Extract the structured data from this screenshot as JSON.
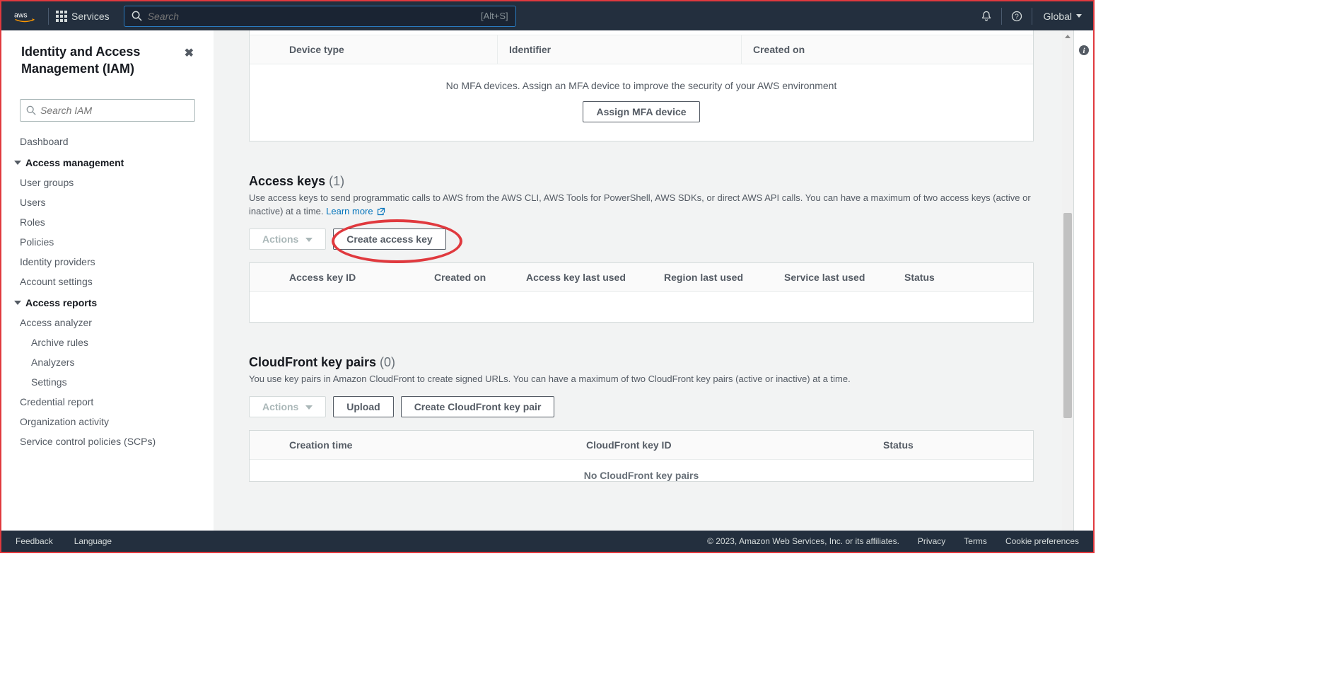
{
  "topnav": {
    "services_label": "Services",
    "search_placeholder": "Search",
    "search_hint": "[Alt+S]",
    "region_label": "Global"
  },
  "sidebar": {
    "title": "Identity and Access Management (IAM)",
    "search_placeholder": "Search IAM",
    "dashboard": "Dashboard",
    "section_access_mgmt": "Access management",
    "items_access_mgmt": {
      "user_groups": "User groups",
      "users": "Users",
      "roles": "Roles",
      "policies": "Policies",
      "identity_providers": "Identity providers",
      "account_settings": "Account settings"
    },
    "section_access_reports": "Access reports",
    "items_access_reports": {
      "access_analyzer": "Access analyzer",
      "archive_rules": "Archive rules",
      "analyzers": "Analyzers",
      "settings": "Settings",
      "credential_report": "Credential report",
      "organization_activity": "Organization activity",
      "scps": "Service control policies (SCPs)"
    }
  },
  "mfa_panel": {
    "columns": {
      "device_type": "Device type",
      "identifier": "Identifier",
      "created_on": "Created on"
    },
    "empty_text": "No MFA devices. Assign an MFA device to improve the security of your AWS environment",
    "assign_button": "Assign MFA device"
  },
  "access_keys": {
    "title": "Access keys",
    "count": "(1)",
    "description": "Use access keys to send programmatic calls to AWS from the AWS CLI, AWS Tools for PowerShell, AWS SDKs, or direct AWS API calls. You can have a maximum of two access keys (active or inactive) at a time.",
    "learn_more": "Learn more",
    "actions_btn": "Actions",
    "create_btn": "Create access key",
    "columns": {
      "access_key_id": "Access key ID",
      "created_on": "Created on",
      "last_used": "Access key last used",
      "region_last_used": "Region last used",
      "service_last_used": "Service last used",
      "status": "Status"
    }
  },
  "cloudfront": {
    "title": "CloudFront key pairs",
    "count": "(0)",
    "description": "You use key pairs in Amazon CloudFront to create signed URLs. You can have a maximum of two CloudFront key pairs (active or inactive) at a time.",
    "actions_btn": "Actions",
    "upload_btn": "Upload",
    "create_btn": "Create CloudFront key pair",
    "columns": {
      "creation_time": "Creation time",
      "key_id": "CloudFront key ID",
      "status": "Status"
    },
    "empty_text": "No CloudFront key pairs"
  },
  "footer": {
    "feedback": "Feedback",
    "language": "Language",
    "copyright": "© 2023, Amazon Web Services, Inc. or its affiliates.",
    "privacy": "Privacy",
    "terms": "Terms",
    "cookie": "Cookie preferences"
  }
}
